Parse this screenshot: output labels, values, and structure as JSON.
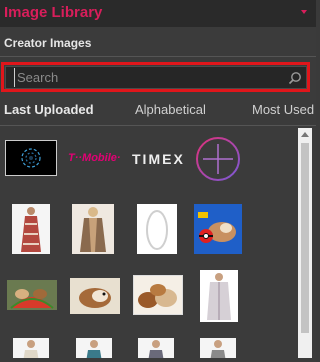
{
  "header": {
    "title": "Image Library"
  },
  "section": {
    "title": "Creator Images"
  },
  "search": {
    "placeholder": "Search",
    "value": ""
  },
  "tabs": [
    {
      "label": "Last Uploaded",
      "active": true
    },
    {
      "label": "Alphabetical",
      "active": false
    },
    {
      "label": "Most Used",
      "active": false
    }
  ],
  "brand_logos": {
    "tmobile": "T··Mobile·",
    "timex": "TIMEX"
  },
  "colors": {
    "accent": "#d81e5b",
    "highlight": "#e0161b",
    "panel": "#3b3b3b"
  }
}
